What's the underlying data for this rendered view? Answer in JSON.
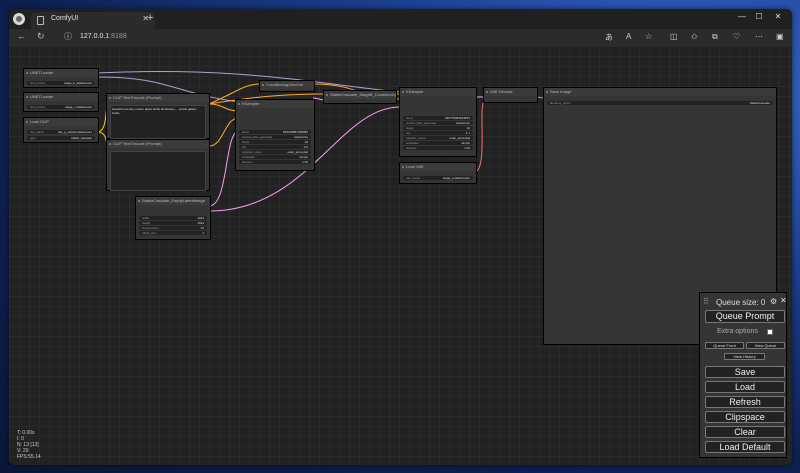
{
  "browser": {
    "tab_title": "ComfyUI",
    "url_host": "127.0.0.1",
    "url_port": ":8188",
    "colors": {
      "chrome": "#202020",
      "toolbar": "#2b2b2b"
    }
  },
  "graph": {
    "nodes": [
      {
        "id": "unet1",
        "title": "UNETLoader",
        "widgets": [
          {
            "name": "unet_name",
            "value": "stage_b_safetensors"
          }
        ]
      },
      {
        "id": "unet2",
        "title": "UNETLoader",
        "widgets": [
          {
            "name": "unet_name",
            "value": "stage_c.safetensors"
          }
        ]
      },
      {
        "id": "clip",
        "title": "Load CLIP",
        "widgets": [
          {
            "name": "clip_name",
            "value": "clip_g_sa(s)ft.safetensors"
          },
          {
            "name": "type",
            "value": "stable_cascade"
          }
        ]
      },
      {
        "id": "pos",
        "title": "CLIP Text Encode (Prompt)",
        "text": "beautiful scenery nature glass bottle landscape , , purple galaxy bottle,"
      },
      {
        "id": "neg",
        "title": "CLIP Text Encode (Prompt)",
        "text": ""
      },
      {
        "id": "ksamp1",
        "title": "KSampler",
        "widgets": [
          {
            "name": "seed",
            "value": "815138887938080"
          },
          {
            "name": "control_after_generate",
            "value": "randomize"
          },
          {
            "name": "steps",
            "value": "20"
          },
          {
            "name": "cfg",
            "value": "4.0"
          },
          {
            "name": "sampler_name",
            "value": "euler_ancestral"
          },
          {
            "name": "scheduler",
            "value": "simple"
          },
          {
            "name": "denoise",
            "value": "1.00"
          }
        ]
      },
      {
        "id": "zero",
        "title": "ConditioningZeroOut"
      },
      {
        "id": "sbc",
        "title": "StableCascade_StageB_Conditioning"
      },
      {
        "id": "ksamp2",
        "title": "KSampler",
        "widgets": [
          {
            "name": "seed",
            "value": "326776984919873"
          },
          {
            "name": "control_after_generate",
            "value": "randomize"
          },
          {
            "name": "steps",
            "value": "10"
          },
          {
            "name": "cfg",
            "value": "1.1"
          },
          {
            "name": "sampler_name",
            "value": "euler_ancestral"
          },
          {
            "name": "scheduler",
            "value": "simple"
          },
          {
            "name": "denoise",
            "value": "1.00"
          }
        ]
      },
      {
        "id": "vae",
        "title": "Load VAE",
        "widgets": [
          {
            "name": "vae_name",
            "value": "stage_a.safetensors"
          }
        ]
      },
      {
        "id": "decode",
        "title": "VAE Decode"
      },
      {
        "id": "save",
        "title": "Save Image",
        "widgets": [
          {
            "name": "filename_prefix",
            "value": "StableCascade"
          }
        ]
      },
      {
        "id": "latent",
        "title": "StableCascade_EmptyLatentImage",
        "widgets": [
          {
            "name": "width",
            "value": "1024"
          },
          {
            "name": "height",
            "value": "1024"
          },
          {
            "name": "compression",
            "value": "42"
          },
          {
            "name": "batch_size",
            "value": "1"
          }
        ]
      }
    ],
    "link_colors": {
      "model": "#b39ddb",
      "clip": "#ffd500",
      "conditioning": "#ffa931",
      "latent": "#ff9cf9",
      "vae": "#ff6e6e",
      "image": "#64b5f6"
    }
  },
  "queue_panel": {
    "queue_size": "Queue size: 0",
    "queue_prompt": "Queue Prompt",
    "extra_options": "Extra options",
    "queue_front": "Queue Front",
    "view_queue": "View Queue",
    "view_history": "View History",
    "save": "Save",
    "load": "Load",
    "refresh": "Refresh",
    "clipspace": "Clipspace",
    "clear": "Clear",
    "load_default": "Load Default"
  },
  "stats": {
    "t": "T: 0.00s",
    "i": "I: 0",
    "n": "N: 13 [13]",
    "v": "V: 29",
    "fps": "FPS:55.14"
  }
}
